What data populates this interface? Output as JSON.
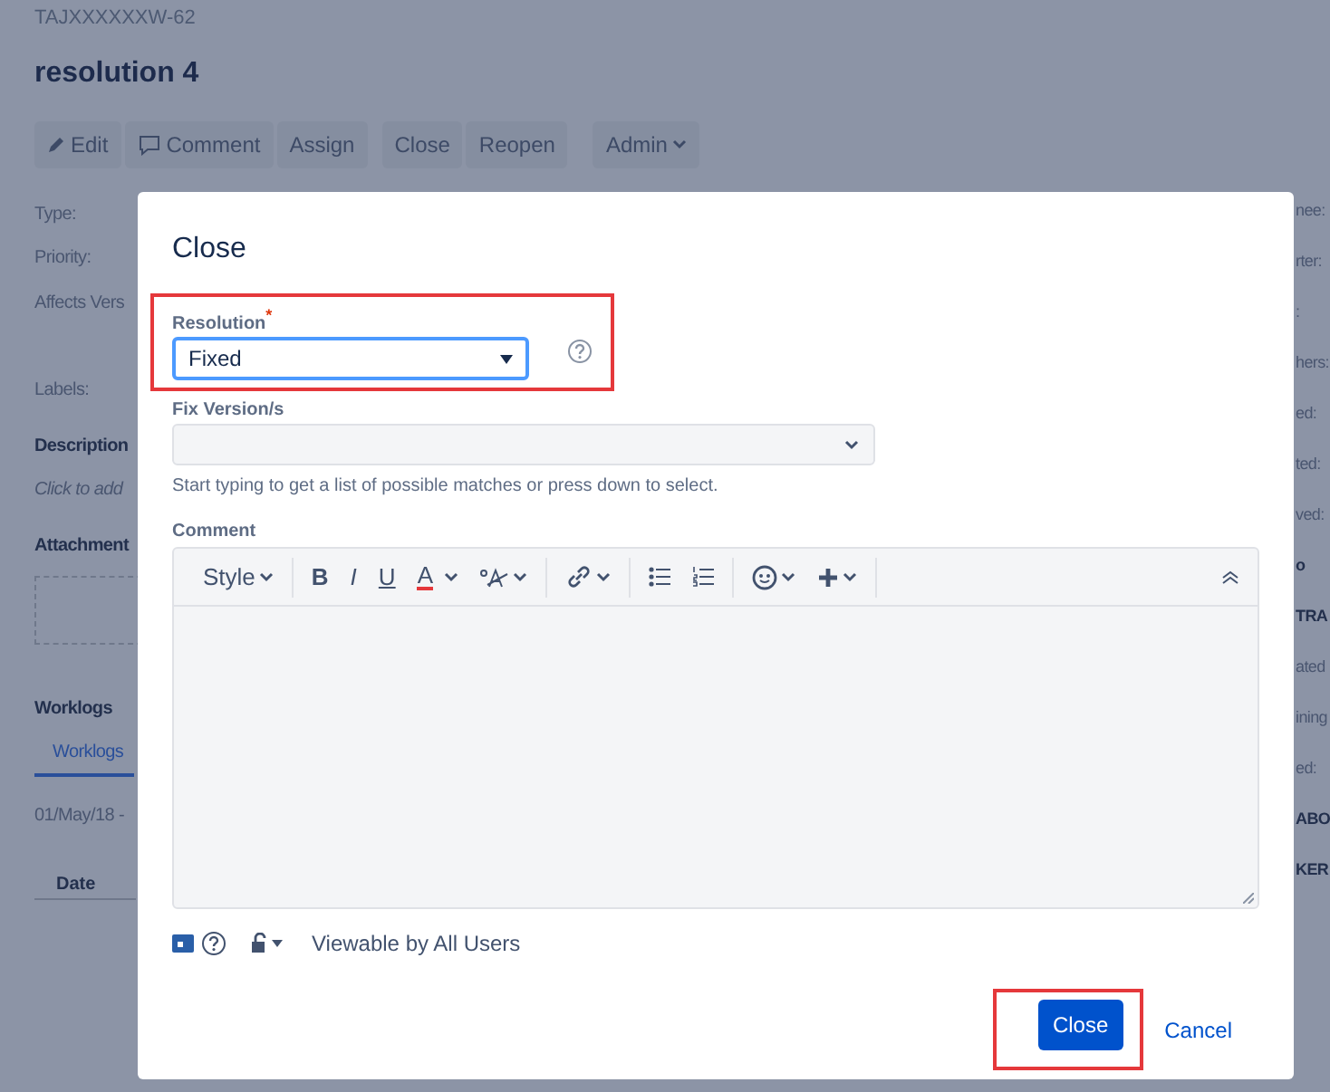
{
  "issue": {
    "key": "TAJXXXXXXW-62",
    "title": "resolution 4"
  },
  "toolbar": [
    [
      {
        "kind": "edit",
        "label": "Edit"
      },
      {
        "kind": "comment",
        "label": "Comment"
      },
      {
        "kind": "plain",
        "label": "Assign"
      }
    ],
    [
      {
        "kind": "plain",
        "label": "Close"
      },
      {
        "kind": "plain",
        "label": "Reopen"
      }
    ],
    [
      {
        "kind": "dropdown",
        "label": "Admin"
      }
    ]
  ],
  "left_fields": [
    {
      "kind": "label",
      "text": "Type:"
    },
    {
      "kind": "label",
      "text": "Priority:"
    },
    {
      "kind": "label",
      "text": "Affects Vers"
    },
    {
      "kind": "label",
      "text": "Labels:"
    },
    {
      "kind": "heading",
      "text": "Description"
    },
    {
      "kind": "hint",
      "text": "Click to add"
    },
    {
      "kind": "heading",
      "text": "Attachment"
    },
    {
      "kind": "dropzone"
    },
    {
      "kind": "heading",
      "text": "Worklogs"
    },
    {
      "kind": "tab",
      "text": "Worklogs"
    },
    {
      "kind": "label",
      "text": "01/May/18 -"
    },
    {
      "kind": "column",
      "text": "Date"
    }
  ],
  "right_fields": [
    {
      "kind": "label",
      "text": "nee:"
    },
    {
      "kind": "label",
      "text": "rter:"
    },
    {
      "kind": "label",
      "text": ":"
    },
    {
      "kind": "label",
      "text": "hers:"
    },
    {
      "kind": "label",
      "text": "ed:"
    },
    {
      "kind": "label",
      "text": "ted:"
    },
    {
      "kind": "label",
      "text": "ved:"
    },
    {
      "kind": "heading",
      "text": "o"
    },
    {
      "kind": "heading",
      "text": "TRA"
    },
    {
      "kind": "label",
      "text": "ated"
    },
    {
      "kind": "label",
      "text": "ining"
    },
    {
      "kind": "label",
      "text": "ed:"
    },
    {
      "kind": "heading",
      "text": "ABO"
    },
    {
      "kind": "heading",
      "text": "KER"
    }
  ],
  "dialog": {
    "title": "Close",
    "resolution": {
      "label": "Resolution",
      "required_mark": "*",
      "value": "Fixed",
      "highlighted": true
    },
    "fix_versions": {
      "label": "Fix Version/s",
      "help": "Start typing to get a list of possible matches or press down to select."
    },
    "comment": {
      "label": "Comment",
      "style_label": "Style",
      "tools": [
        [
          {
            "kind": "bold",
            "label": "B"
          },
          {
            "kind": "italic",
            "label": "I"
          },
          {
            "kind": "underline",
            "label": "U"
          },
          {
            "kind": "color",
            "label": "A"
          },
          {
            "kind": "textstyle"
          }
        ],
        [
          {
            "kind": "link"
          }
        ],
        [
          {
            "kind": "bullets"
          },
          {
            "kind": "numbers"
          }
        ],
        [
          {
            "kind": "emoji"
          },
          {
            "kind": "insert"
          }
        ]
      ],
      "visibility": "Viewable by All Users"
    },
    "submit": {
      "label": "Close",
      "highlighted": true
    },
    "cancel": "Cancel"
  }
}
